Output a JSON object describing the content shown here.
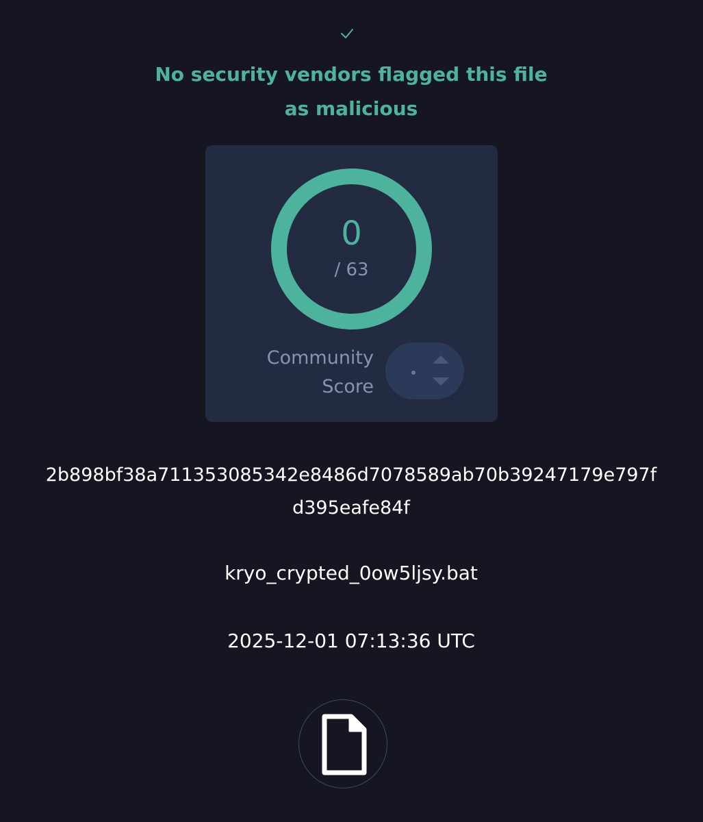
{
  "report": {
    "verdict_icon": "check-icon",
    "verdict_text": "No security vendors flagged this file as malicious",
    "accent_color": "#4db39c"
  },
  "score": {
    "detections": "0",
    "total": "/ 63",
    "community_label": "Community Score",
    "community_value_icon": "dot",
    "vote_up_icon": "triangle-up-icon",
    "vote_down_icon": "triangle-down-icon"
  },
  "file": {
    "hash": "2b898bf38a711353085342e8486d7078589ab70b39247179e797fd395eafe84f",
    "name": "kryo_crypted_0ow5ljsy.bat",
    "date": "2025-12-01 07:13:36 UTC",
    "type_icon": "file-icon"
  }
}
